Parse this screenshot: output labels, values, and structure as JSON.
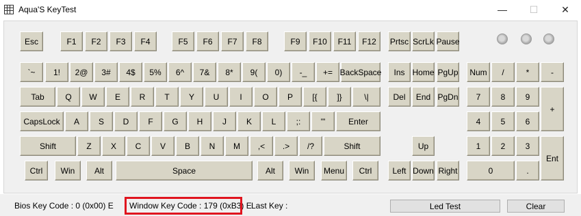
{
  "window": {
    "title": "Aqua'S KeyTest",
    "minimize": "—",
    "maximize": "☐",
    "close": "✕"
  },
  "keys": {
    "esc": "Esc",
    "f1": "F1",
    "f2": "F2",
    "f3": "F3",
    "f4": "F4",
    "f5": "F5",
    "f6": "F6",
    "f7": "F7",
    "f8": "F8",
    "f9": "F9",
    "f10": "F10",
    "f11": "F11",
    "f12": "F12",
    "prtsc": "Prtsc",
    "scrlk": "ScrLk",
    "pause": "Pause",
    "tilde": "`~",
    "k1": "1!",
    "k2": "2@",
    "k3": "3#",
    "k4": "4$",
    "k5": "5%",
    "k6": "6^",
    "k7": "7&",
    "k8": "8*",
    "k9": "9(",
    "k0": "0)",
    "minus": "-_",
    "equals": "+=",
    "backspace": "BackSpace",
    "ins": "Ins",
    "home": "Home",
    "pgup": "PgUp",
    "num": "Num",
    "np_div": "/",
    "np_mul": "*",
    "np_sub": "-",
    "tab": "Tab",
    "q": "Q",
    "w": "W",
    "e": "E",
    "r": "R",
    "t": "T",
    "y": "Y",
    "u": "U",
    "i": "I",
    "o": "O",
    "p": "P",
    "lbracket": "[{",
    "rbracket": "]}",
    "backslash": "\\|",
    "del": "Del",
    "end": "End",
    "pgdn": "PgDn",
    "np7": "7",
    "np8": "8",
    "np9": "9",
    "np_add": "+",
    "capslock": "CapsLock",
    "a": "A",
    "s": "S",
    "d": "D",
    "f": "F",
    "g": "G",
    "h": "H",
    "j": "J",
    "k": "K",
    "l": "L",
    "semicolon": ";:",
    "quote": "'\"",
    "enter": "Enter",
    "np4": "4",
    "np5": "5",
    "np6": "6",
    "lshift": "Shift",
    "z": "Z",
    "x": "X",
    "c": "C",
    "v": "V",
    "b": "B",
    "n": "N",
    "m": "M",
    "comma": ",<",
    "period": ".>",
    "slash": "/?",
    "rshift": "Shift",
    "up": "Up",
    "np1": "1",
    "np2": "2",
    "np3": "3",
    "np_ent": "Ent",
    "lctrl": "Ctrl",
    "lwin": "Win",
    "lalt": "Alt",
    "space": "Space",
    "ralt": "Alt",
    "rwin": "Win",
    "menu": "Menu",
    "rctrl": "Ctrl",
    "left": "Left",
    "down": "Down",
    "right": "Right",
    "np0": "0",
    "np_dot": "."
  },
  "status": {
    "bios": "Bios Key Code : 0 (0x00) E",
    "window": "Window Key Code : 179 (0xB3) E",
    "last": "Last Key :",
    "led_test": "Led Test",
    "clear": "Clear"
  },
  "colors": {
    "key_face": "#d8d5c6",
    "highlight": "#e0141e"
  }
}
